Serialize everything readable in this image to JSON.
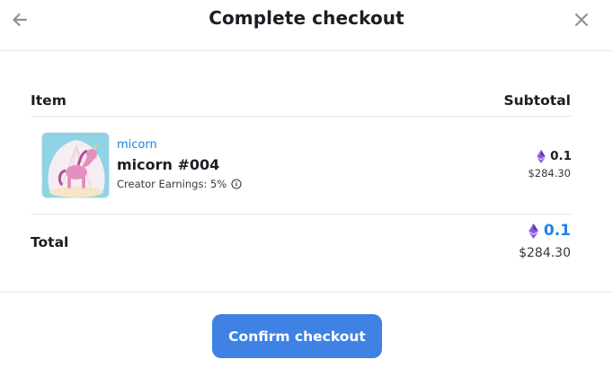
{
  "header": {
    "title": "Complete checkout",
    "back_icon": "arrow-left-icon",
    "close_icon": "close-icon"
  },
  "table": {
    "item_header": "Item",
    "subtotal_header": "Subtotal"
  },
  "item": {
    "collection": "micorn",
    "name": "micorn #004",
    "creator_earnings": "Creator Earnings: 5%",
    "info_icon": "info-icon",
    "currency_icon": "ethereum-icon",
    "price_eth": "0.1",
    "price_usd": "$284.30"
  },
  "total": {
    "label": "Total",
    "price_eth": "0.1",
    "price_usd": "$284.30"
  },
  "actions": {
    "confirm_label": "Confirm checkout"
  },
  "colors": {
    "accent": "#2081e2",
    "button": "#3f82e4",
    "eth_purple": "#7b4ccf",
    "divider": "#e5e8eb"
  }
}
